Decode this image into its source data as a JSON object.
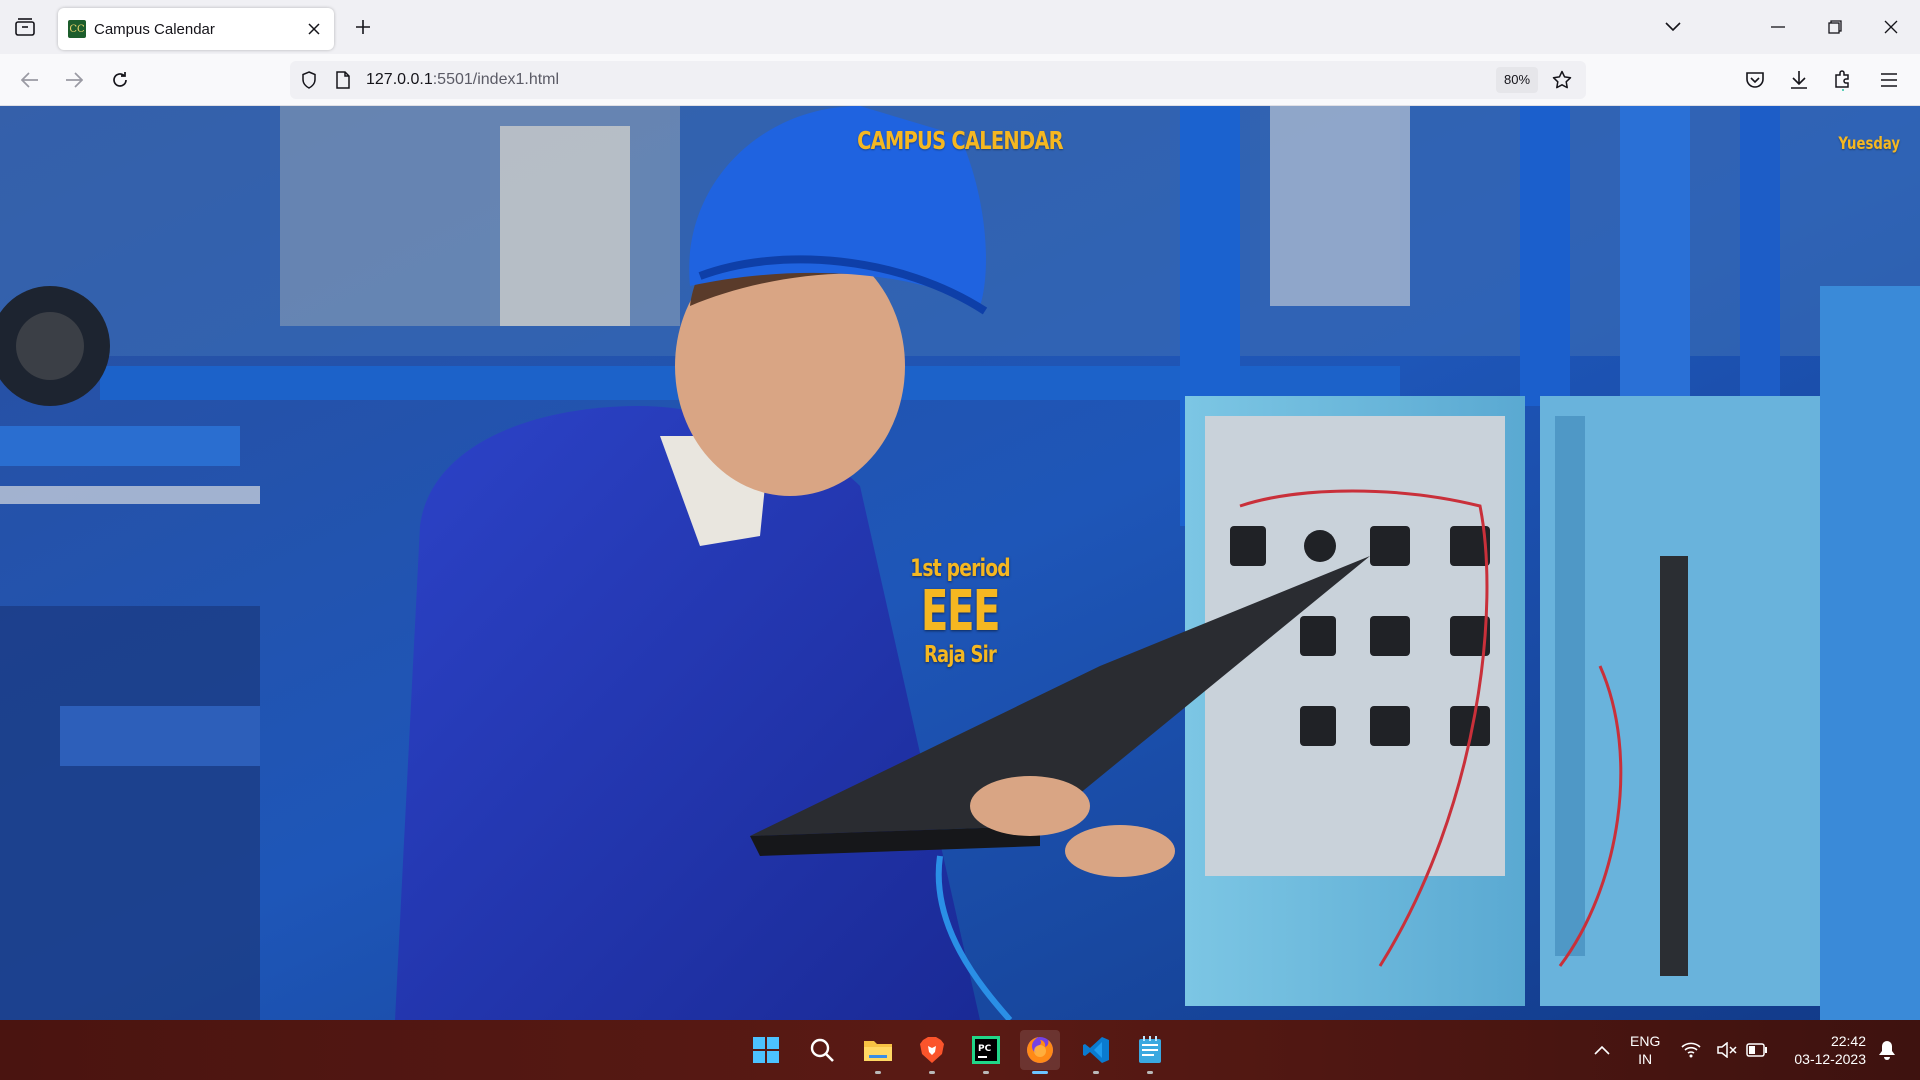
{
  "browser": {
    "tab_title": "Campus Calendar",
    "favicon_text": "CC",
    "url_host": "127.0.0.1",
    "url_rest": ":5501/index1.html",
    "zoom": "80%"
  },
  "page": {
    "title": "CAMPUS CALENDAR",
    "day": "Yuesday",
    "period": "1st period",
    "subject": "EEE",
    "teacher": "Raja Sir",
    "accent_color": "#f5b721"
  },
  "taskbar": {
    "apps": [
      "start-icon",
      "search-icon",
      "file-explorer-icon",
      "brave-icon",
      "pycharm-icon",
      "firefox-icon",
      "vscode-icon",
      "notepad-icon"
    ],
    "lang_line1": "ENG",
    "lang_line2": "IN",
    "time": "22:42",
    "date": "03-12-2023"
  }
}
